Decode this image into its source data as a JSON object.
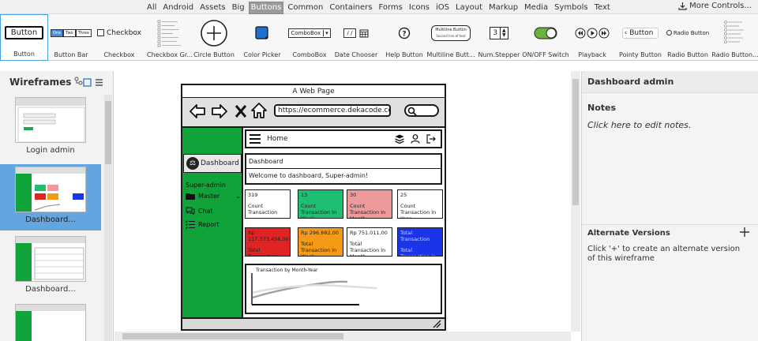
{
  "categories": [
    "All",
    "Android",
    "Assets",
    "Big",
    "Buttons",
    "Common",
    "Containers",
    "Forms",
    "Icons",
    "iOS",
    "Layout",
    "Markup",
    "Media",
    "Symbols",
    "Text"
  ],
  "active_category": "Buttons",
  "more_controls": "More Controls...",
  "library": {
    "button": {
      "label": "Button",
      "preview": "Button"
    },
    "button_bar": {
      "label": "Button Bar",
      "segments": [
        "One",
        "Two",
        "Three"
      ]
    },
    "checkbox": {
      "label": "Checkbox",
      "preview": "Checkbox"
    },
    "checkbox_group": {
      "label": "Checkbox Gr..."
    },
    "circle_button": {
      "label": "Circle Button"
    },
    "color_picker": {
      "label": "Color Picker"
    },
    "combobox": {
      "label": "ComboBox",
      "preview": "ComboBox"
    },
    "date_chooser": {
      "label": "Date Chooser",
      "preview": "/ /"
    },
    "help_button": {
      "label": "Help Button"
    },
    "multiline_button": {
      "label": "Multiline Butt...",
      "preview_line1": "Multiline Button",
      "preview_line2": "Second line of text"
    },
    "num_stepper": {
      "label": "Num.Stepper",
      "preview": "3"
    },
    "on_off": {
      "label": "ON/OFF Switch"
    },
    "playback": {
      "label": "Playback"
    },
    "pointy_button": {
      "label": "Pointy Button",
      "preview": "Button"
    },
    "radio_button": {
      "label": "Radio Button",
      "preview": "Radio Button"
    },
    "radio_button_group": {
      "label": "Radio Button..."
    }
  },
  "left_panel": {
    "title": "Wireframes",
    "items": [
      {
        "label": "Login admin"
      },
      {
        "label": "Dashboard..."
      },
      {
        "label": "Dashboard..."
      },
      {
        "label": ""
      }
    ]
  },
  "wireframe": {
    "window_title": "A Web Page",
    "url": "https://ecommerce.dekacode.co",
    "brand": "Dashboard",
    "role": "Super-admin",
    "menu": [
      {
        "label": "Master",
        "icon": "folder-icon"
      },
      {
        "label": "Chat",
        "icon": "chat-icon"
      },
      {
        "label": "Report",
        "icon": "list-icon"
      }
    ],
    "home": "Home",
    "crumb_title": "Dashboard",
    "welcome": "Welcome to dashboard, Super-admin!",
    "cards_row1": [
      {
        "value": "319",
        "caption": "Count Transaction",
        "color": "#ffffff"
      },
      {
        "value": "13",
        "caption": "Count Transaction In Week",
        "color": "#1fbf73"
      },
      {
        "value": "30",
        "caption": "Count Transaction In Month",
        "color": "#ee9a9a"
      },
      {
        "value": "25",
        "caption": "Count Transaction In Year",
        "color": "#ffffff"
      }
    ],
    "cards_row2": [
      {
        "value": "Rp 117.373.458,00",
        "caption": "Total Transaction",
        "color": "#e02424"
      },
      {
        "value": "Rp 296.882,00",
        "caption": "Total Transaction In Week",
        "color": "#f59a16"
      },
      {
        "value": "Rp 751.011,00",
        "caption": "Total Transaction In Month",
        "color": "#ffffff"
      },
      {
        "value": "Total Transaction",
        "caption": "Total Transaction In Year",
        "color": "#1c34e8"
      }
    ],
    "chart_title": "Transaction by Month-Year"
  },
  "right_panel": {
    "title": "Dashboard admin",
    "notes_heading": "Notes",
    "notes_placeholder": "Click here to edit notes.",
    "alt_heading": "Alternate Versions",
    "alt_text": "Click '+' to create an alternate version of this wireframe"
  }
}
